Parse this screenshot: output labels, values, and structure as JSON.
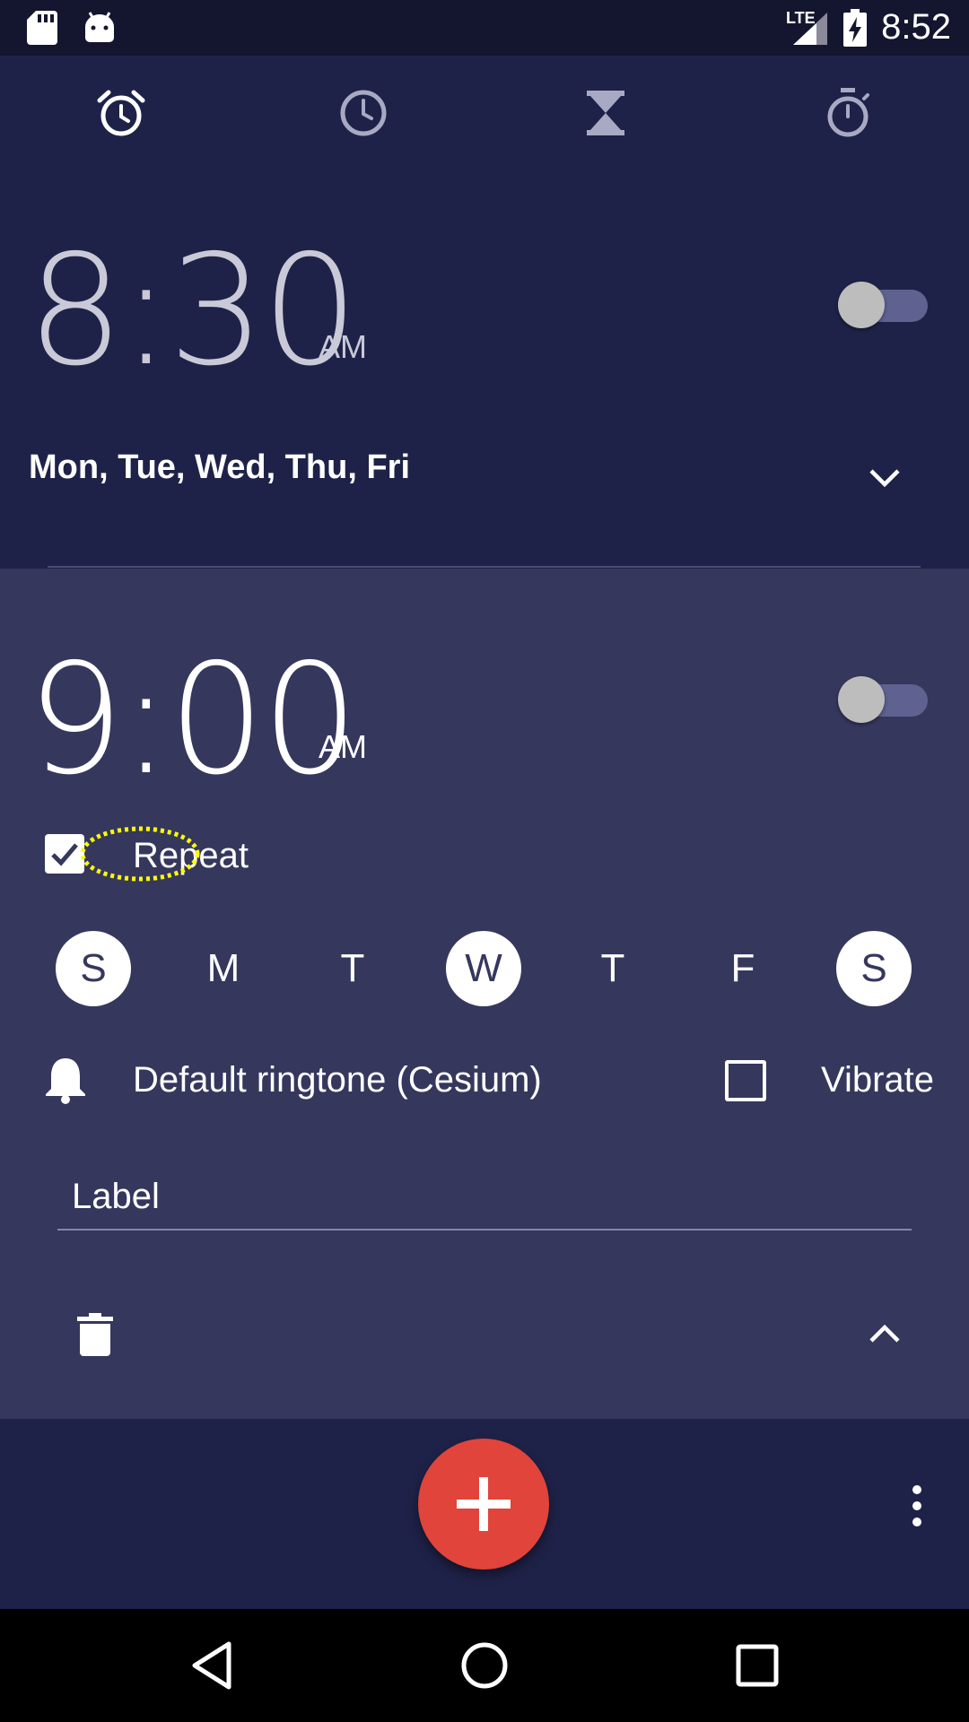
{
  "status_bar": {
    "time": "8:52",
    "network": "LTE",
    "icons": [
      "sd-card-icon",
      "android-icon",
      "signal-icon",
      "battery-charging-icon"
    ]
  },
  "tabs": [
    {
      "name": "alarm",
      "icon": "alarm-clock-icon",
      "active": true
    },
    {
      "name": "clock",
      "icon": "clock-icon",
      "active": false
    },
    {
      "name": "timer",
      "icon": "hourglass-icon",
      "active": false
    },
    {
      "name": "stopwatch",
      "icon": "stopwatch-icon",
      "active": false
    }
  ],
  "alarms": [
    {
      "time": "8:30",
      "ampm": "AM",
      "enabled": false,
      "days_summary": "Mon, Tue, Wed, Thu, Fri",
      "expanded": false
    },
    {
      "time": "9:00",
      "ampm": "AM",
      "enabled": false,
      "expanded": true,
      "repeat_label": "Repeat",
      "repeat_checked": true,
      "days": [
        {
          "letter": "S",
          "selected": true
        },
        {
          "letter": "M",
          "selected": false
        },
        {
          "letter": "T",
          "selected": false
        },
        {
          "letter": "W",
          "selected": true
        },
        {
          "letter": "T",
          "selected": false
        },
        {
          "letter": "F",
          "selected": false
        },
        {
          "letter": "S",
          "selected": true
        }
      ],
      "ringtone": "Default ringtone (Cesium)",
      "vibrate_label": "Vibrate",
      "vibrate_checked": false,
      "label_placeholder": "Label"
    }
  ],
  "colors": {
    "background": "#1f2248",
    "expanded_card": "#35375d",
    "fab": "#e0443a",
    "highlight": "#ffff00"
  }
}
